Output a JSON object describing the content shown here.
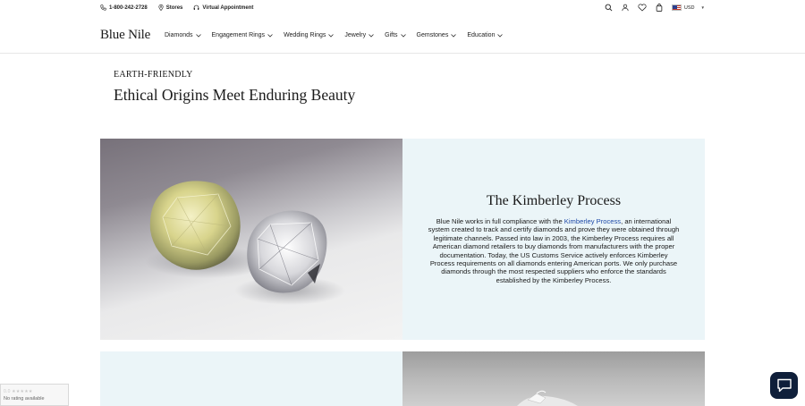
{
  "topbar": {
    "phone": "1-800-242-2728",
    "stores": "Stores",
    "appointment": "Virtual Appointment",
    "currency": "USD",
    "icons": [
      "search-icon",
      "account-icon",
      "heart-icon",
      "bag-icon",
      "us-flag-icon"
    ]
  },
  "brand": {
    "logo": "Blue Nile"
  },
  "nav": {
    "items": [
      {
        "label": "Diamonds"
      },
      {
        "label": "Engagement Rings"
      },
      {
        "label": "Wedding Rings"
      },
      {
        "label": "Jewelry"
      },
      {
        "label": "Gifts"
      },
      {
        "label": "Gemstones"
      },
      {
        "label": "Education"
      }
    ]
  },
  "hero": {
    "eyebrow": "EARTH-FRIENDLY",
    "headline": "Ethical Origins Meet Enduring Beauty"
  },
  "feature1": {
    "title": "The Kimberley Process",
    "body_before": "Blue Nile works in full compliance with the ",
    "link": "Kimberley Process",
    "body_after": ", an international system created to track and certify diamonds and prove they were obtained through legitimate channels. Passed into law in 2003, the Kimberley Process requires all American diamond retailers to buy diamonds from manufacturers with the proper documentation. Today, the US Customs Service actively enforces Kimberley Process requirements on all diamonds entering American ports. We only purchase diamonds through the most respected suppliers who enforce the standards established by the Kimberley Process.",
    "link_color": "#1f4aa8",
    "panel_color": "#ebf5f8"
  },
  "rating_widget": {
    "score": "0.0",
    "stars": "★★★★★",
    "text": "No rating available"
  },
  "colors": {
    "chat_button": "#0f1f3a"
  }
}
